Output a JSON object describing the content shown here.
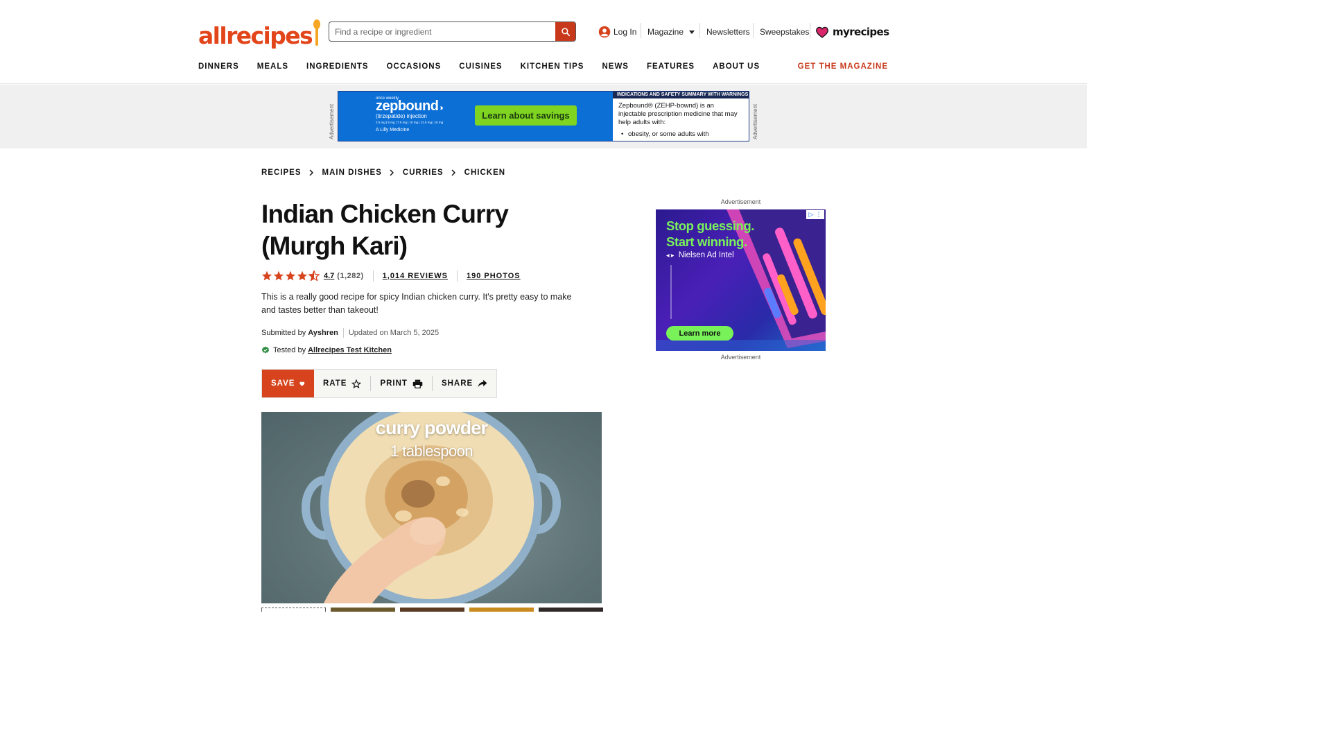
{
  "header": {
    "logo_text": "allrecipes",
    "search": {
      "placeholder": "Find a recipe or ingredient",
      "value": ""
    },
    "util_links": {
      "login": "Log In",
      "magazine": "Magazine",
      "newsletters": "Newsletters",
      "sweepstakes": "Sweepstakes",
      "myrecipes": "myrecipes"
    },
    "nav": [
      "DINNERS",
      "MEALS",
      "INGREDIENTS",
      "OCCASIONS",
      "CUISINES",
      "KITCHEN TIPS",
      "NEWS",
      "FEATURES",
      "ABOUT US"
    ],
    "get_magazine": "GET THE MAGAZINE"
  },
  "top_ad": {
    "label": "Advertisement",
    "small": "once weekly",
    "brand": "zepbound",
    "sub": "(tirzepatide) injection",
    "dose": "2.5 mg | 5 mg | 7.5 mg | 10 mg | 12.5 mg | 15 mg",
    "maker": "A Lilly Medicine",
    "cta": "Learn about savings",
    "safety_header": "INDICATIONS AND SAFETY SUMMARY WITH WARNINGS",
    "safety_text": "Zepbound® (ZEHP-bownd) is an injectable prescription medicine that may help adults with:",
    "safety_bullet": "obesity, or some adults with"
  },
  "breadcrumb": [
    "RECIPES",
    "MAIN DISHES",
    "CURRIES",
    "CHICKEN"
  ],
  "recipe": {
    "title": "Indian Chicken Curry (Murgh Kari)",
    "rating_value": "4.7",
    "rating_count": "(1,282)",
    "stars_filled": 4.5,
    "reviews": "1,014 REVIEWS",
    "photos": "190 PHOTOS",
    "description": "This is a really good recipe for spicy Indian chicken curry. It's pretty easy to make and tastes better than takeout!",
    "submitted_label": "Submitted by",
    "author": "Ayshren",
    "updated": "Updated on March 5, 2025",
    "tested_label": "Tested by",
    "tested_by": "Allrecipes Test Kitchen"
  },
  "actions": {
    "save": "SAVE",
    "rate": "RATE",
    "print": "PRINT",
    "share": "SHARE"
  },
  "hero": {
    "caption_title": "curry powder",
    "caption_amount": "1 tablespoon"
  },
  "side_ad": {
    "label_top": "Advertisement",
    "label_bottom": "Advertisement",
    "headline_1": "Stop guessing.",
    "headline_2": "Start winning.",
    "brand": "Nielsen Ad Intel",
    "cta": "Learn more"
  },
  "colors": {
    "brand": "#e3451b",
    "accent": "#c8391b",
    "save": "#d6431c",
    "star": "#d6431c",
    "myrecipes": "#d9266b"
  }
}
